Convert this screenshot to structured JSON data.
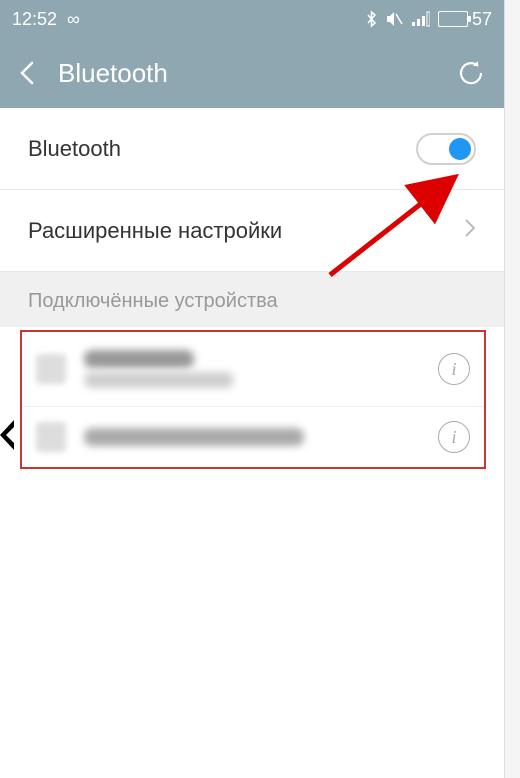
{
  "status_bar": {
    "time": "12:52",
    "infinity": "∞",
    "battery_percent": "57"
  },
  "header": {
    "title": "Bluetooth"
  },
  "rows": {
    "bluetooth_label": "Bluetooth",
    "advanced_label": "Расширенные настройки"
  },
  "section": {
    "connected_label": "Подключённые устройства"
  },
  "icons": {
    "info": "i"
  }
}
